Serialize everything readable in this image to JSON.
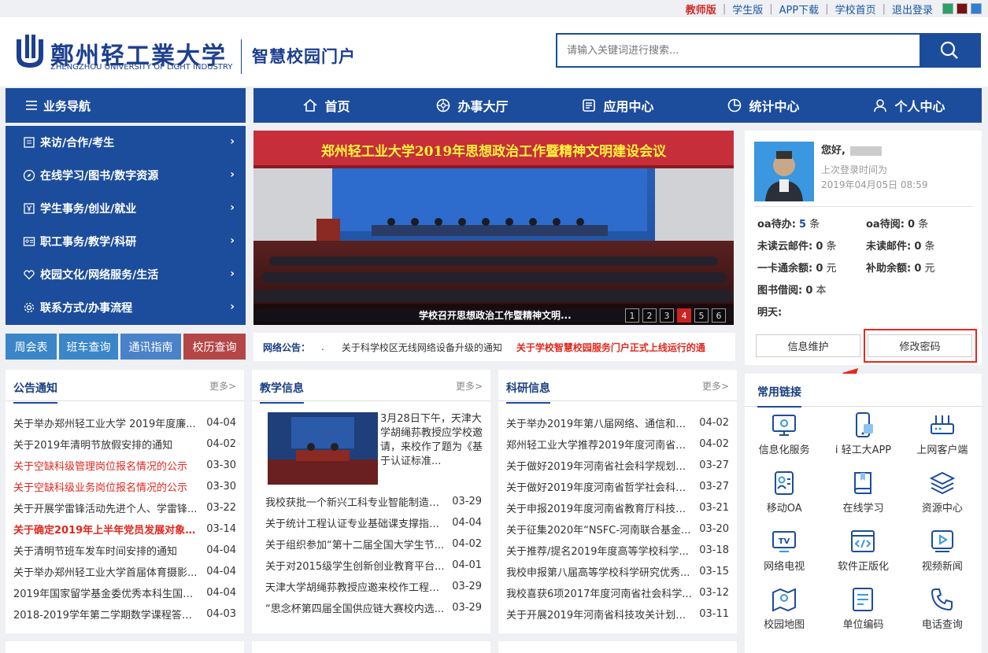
{
  "topbar": {
    "teacher": "教师版",
    "student": "学生版",
    "app": "APP下载",
    "home": "学校首页",
    "logout": "退出登录"
  },
  "header": {
    "logo_cn": "鄭州轻工業大学",
    "logo_en": "ZHENGZHOU UNIVERSITY OF LIGHT INDUSTRY",
    "portal": "智慧校园门户"
  },
  "search": {
    "placeholder": "请输入关键词进行搜索..."
  },
  "sidenav": {
    "title": "业务导航",
    "items": [
      "来访/合作/考生",
      "在线学习/图书/数字资源",
      "学生事务/创业/就业",
      "职工事务/教学/科研",
      "校园文化/网络服务/生活",
      "联系方式/办事流程"
    ]
  },
  "mainnav": [
    "首页",
    "办事大厅",
    "应用中心",
    "统计中心",
    "个人中心"
  ],
  "quick": [
    "周会表",
    "班车查询",
    "通讯指南",
    "校历查询"
  ],
  "banner": {
    "headline": "郑州轻工业大学2019年思想政治工作暨精神文明建设会议",
    "caption": "学校召开思想政治工作暨精神文明...",
    "pages": [
      "1",
      "2",
      "3",
      "4",
      "5",
      "6"
    ],
    "active_page": "4"
  },
  "notice": {
    "label": "网络公告：",
    "dot": ".",
    "item1": "关于科学校区无线网络设备升级的通知",
    "item2": "关于学校智慧校园服务门户正式上线运行的通"
  },
  "user": {
    "greeting": "您好,",
    "last_login_label": "上次登录时间为",
    "last_login": "2019年04月05日 08:59",
    "stats": [
      [
        "oa待办:",
        "5",
        "条"
      ],
      [
        "oa待阅:",
        "0",
        "条"
      ],
      [
        "未读云邮件:",
        "0",
        "条"
      ],
      [
        "未读邮件:",
        "0",
        "条"
      ],
      [
        "一卡通余额:",
        "0",
        "元"
      ],
      [
        "补助余额:",
        "0",
        "元"
      ],
      [
        "图书借阅:",
        "0",
        "本"
      ]
    ],
    "tomorrow": "明天:",
    "btn_info": "信息维护",
    "btn_pwd": "修改密码"
  },
  "links": {
    "title": "常用链接",
    "items": [
      "信息化服务",
      "i 轻工大APP",
      "上网客户端",
      "移动OA",
      "在线学习",
      "资源中心",
      "网络电视",
      "软件正版化",
      "视频新闻",
      "校园地图",
      "单位编码",
      "电话查询"
    ]
  },
  "more": "更多>",
  "announce": {
    "title": "公告通知",
    "rows": [
      [
        "关于举办郑州轻工业大学 2019年度廉...",
        "04-04",
        ""
      ],
      [
        "关于2019年清明节放假安排的通知",
        "04-02",
        ""
      ],
      [
        "关于空缺科级管理岗位报名情况的公示",
        "03-30",
        "red"
      ],
      [
        "关于空缺科级业务岗位报名情况的公示",
        "03-30",
        "red"
      ],
      [
        "关于开展学雷锋活动先进个人、学雷锋...",
        "03-22",
        ""
      ],
      [
        "关于确定2019年上半年党员发展对象有...",
        "03-14",
        "redb"
      ],
      [
        "关于清明节班车发车时间安排的通知",
        "04-04",
        ""
      ],
      [
        "关于举办郑州轻工业大学首届体育摄影...",
        "04-04",
        ""
      ],
      [
        "2019年国家留学基金委优秀本科生国际...",
        "04-04",
        ""
      ],
      [
        "2018-2019学年第二学期数学课程答疑...",
        "04-03",
        ""
      ]
    ]
  },
  "teaching": {
    "title": "教学信息",
    "feature": "3月28日下午，天津大学胡绳荪教授应学校邀请，来校作了题为《基于认证标准...",
    "rows": [
      [
        "我校获批一个新兴工科专业智能制造工...",
        "03-29"
      ],
      [
        "关于统计工程认证专业基础课支撑指标...",
        "04-04"
      ],
      [
        "关于组织参加“第十二届全国大学生节...",
        "04-02"
      ],
      [
        "关于对2015级学生创新创业教育平台...",
        "04-01"
      ],
      [
        "天津大学胡绳荪教授应邀来校作工程教...",
        "03-29"
      ],
      [
        "“思念杯第四届全国供应链大赛校内选...",
        "03-29"
      ]
    ]
  },
  "research": {
    "title": "科研信息",
    "rows": [
      [
        "关于举办2019年第八届网络、通信和计...",
        "04-02"
      ],
      [
        "郑州轻工业大学推荐2019年度河南省教...",
        "04-02"
      ],
      [
        "关于做好2019年河南省社会科学规划决...",
        "03-27"
      ],
      [
        "关于做好2019年度河南省哲学社会科学...",
        "03-27"
      ],
      [
        "关于申报2019年度河南省教育厅科技成...",
        "03-21"
      ],
      [
        "关于征集2020年“NSFC-河南联合基金...",
        "03-20"
      ],
      [
        "关于推荐/提名2019年度高等学校科学...",
        "03-18"
      ],
      [
        "我校申报第八届高等学校科学研究优秀...",
        "03-15"
      ],
      [
        "我校喜获6项2017年度河南省社会科学...",
        "03-12"
      ],
      [
        "关于开展2019年河南省科技攻关计划（...",
        "03-11"
      ]
    ]
  }
}
